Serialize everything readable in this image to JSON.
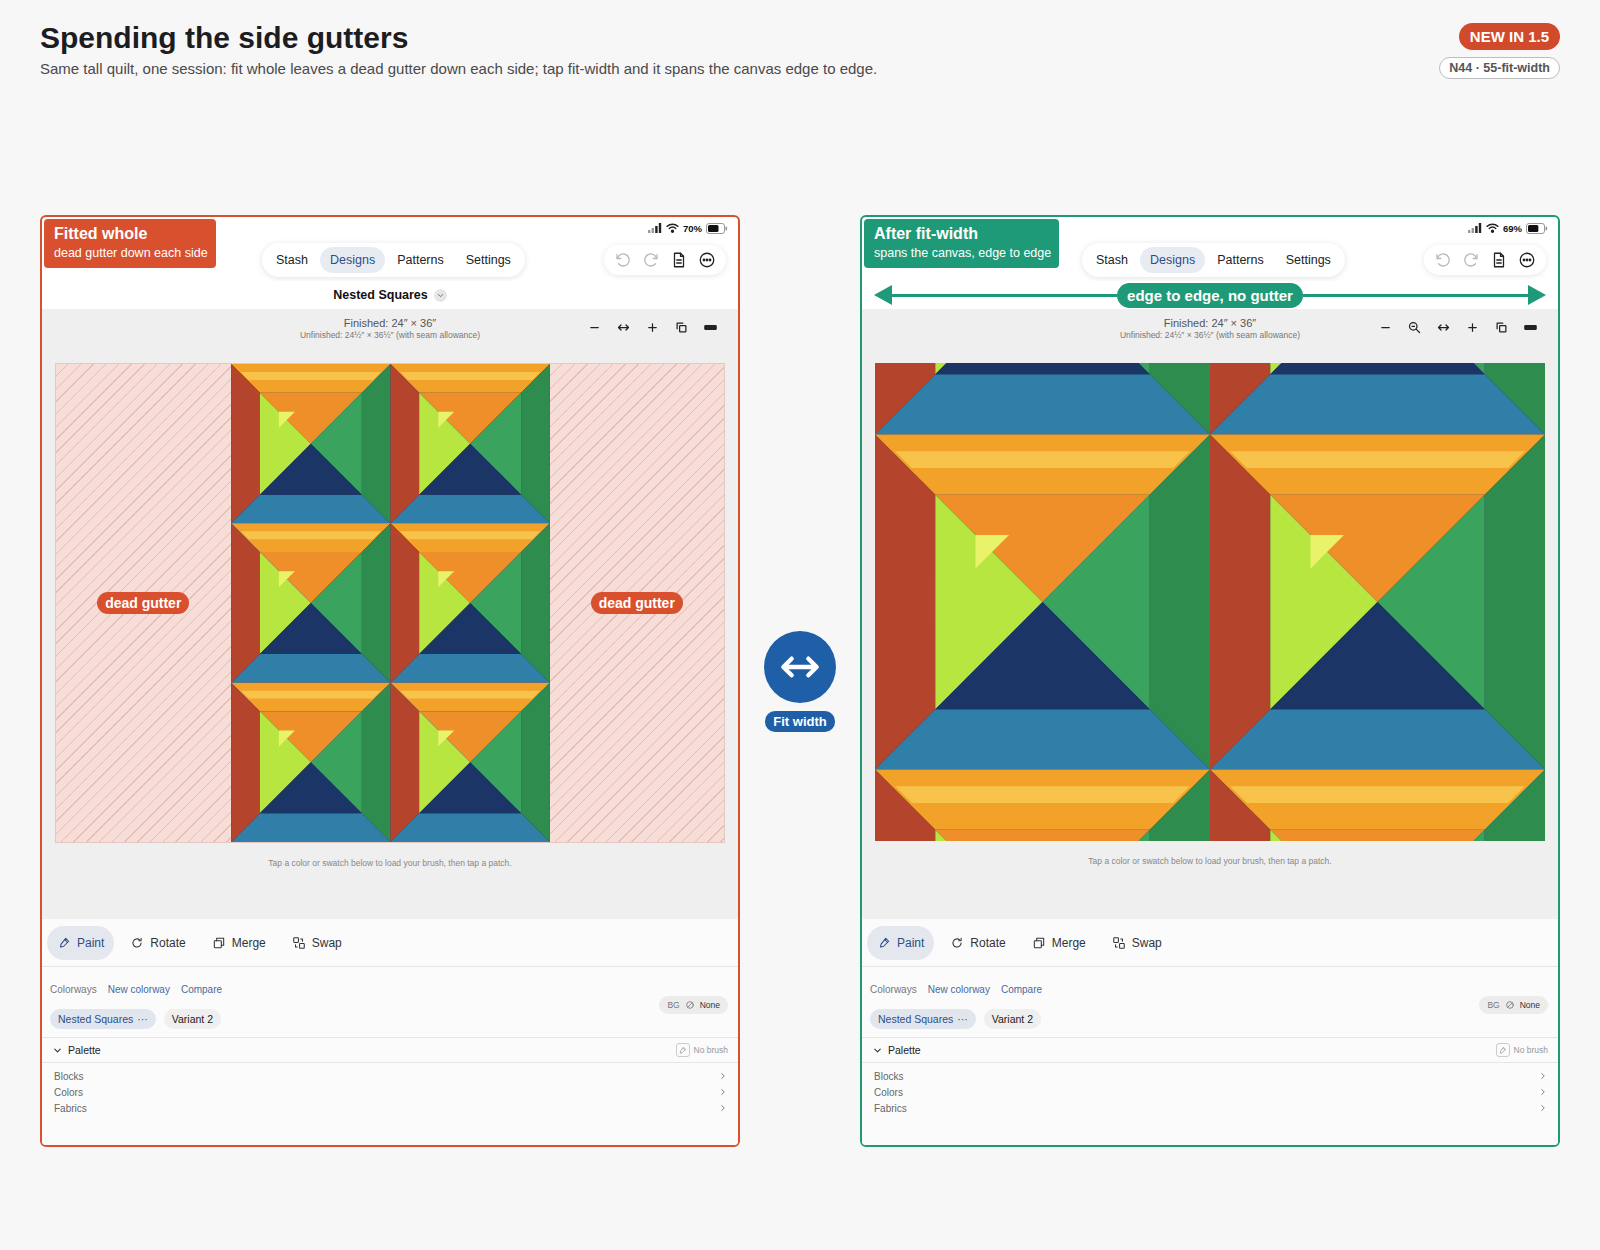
{
  "title": "Spending the side gutters",
  "subtitle": "Same tall quilt, one session: fit whole leaves a dead gutter down each side; tap fit-width and it spans the canvas edge to edge.",
  "badges": [
    {
      "label": "NEW IN 1.5",
      "kind": "filled"
    },
    {
      "label": "N44 · 55-fit-width",
      "kind": "outline"
    }
  ],
  "transition": {
    "label": "Fit width"
  },
  "panels": [
    {
      "fit": "whole",
      "color": "#d9502e",
      "callout": {
        "title": "Fitted whole",
        "subtitle": "dead gutter down each side"
      },
      "gutter_labels": [
        "dead gutter",
        "dead gutter"
      ],
      "span_label": null,
      "status": {
        "battery": "70%",
        "battery_level": 0.7
      },
      "tabs": [
        {
          "label": "Stash",
          "selected": false
        },
        {
          "label": "Designs",
          "selected": true
        },
        {
          "label": "Patterns",
          "selected": false
        },
        {
          "label": "Settings",
          "selected": false
        }
      ],
      "actions": [
        {
          "kind": "undo",
          "disabled": true
        },
        {
          "kind": "redo",
          "disabled": true
        },
        {
          "kind": "doc",
          "disabled": false
        },
        {
          "kind": "more",
          "disabled": false
        }
      ],
      "design_title": "Nested Squares",
      "finished": "Finished: 24″ × 36″",
      "unfinished": "Unfinished: 24½″ × 36½″ (with seam allowance)",
      "canvas_tools": [
        {
          "kind": "zoom-out"
        },
        {
          "kind": "fit-width"
        },
        {
          "kind": "zoom-in"
        },
        {
          "kind": "rotate-canvas"
        },
        {
          "kind": "fit-height"
        }
      ],
      "quilt": {
        "blocks_across": 2,
        "blocks_down": 3
      },
      "hint": "Tap a color or swatch below to load your brush, then tap a patch.",
      "tools": [
        {
          "label": "Paint",
          "kind": "paint",
          "selected": true
        },
        {
          "label": "Rotate",
          "kind": "rotate",
          "selected": false
        },
        {
          "label": "Merge",
          "kind": "merge",
          "selected": false
        },
        {
          "label": "Swap",
          "kind": "swap",
          "selected": false
        }
      ],
      "colorway_links": [
        {
          "label": "Colorways",
          "kind": "heading"
        },
        {
          "label": "New colorway",
          "kind": "link"
        },
        {
          "label": "Compare",
          "kind": "link"
        }
      ],
      "background": {
        "label": "BG",
        "value": "None"
      },
      "colorways": [
        {
          "label": "Nested Squares",
          "more": "···",
          "selected": true
        },
        {
          "label": "Variant 2",
          "more": null,
          "selected": false
        }
      ],
      "palette": {
        "label": "Palette",
        "expanded": true,
        "brush": "No brush",
        "sections": [
          "Blocks",
          "Colors",
          "Fabrics"
        ]
      }
    },
    {
      "fit": "width",
      "color": "#1f9a78",
      "callout": {
        "title": "After fit-width",
        "subtitle": "spans the canvas, edge to edge"
      },
      "gutter_labels": [],
      "span_label": "edge to edge, no gutter",
      "status": {
        "battery": "69%",
        "battery_level": 0.69
      },
      "tabs": [
        {
          "label": "Stash",
          "selected": false
        },
        {
          "label": "Designs",
          "selected": true
        },
        {
          "label": "Patterns",
          "selected": false
        },
        {
          "label": "Settings",
          "selected": false
        }
      ],
      "actions": [
        {
          "kind": "undo",
          "disabled": true
        },
        {
          "kind": "redo",
          "disabled": true
        },
        {
          "kind": "doc",
          "disabled": false
        },
        {
          "kind": "more",
          "disabled": false
        }
      ],
      "design_title": null,
      "finished": "Finished: 24″ × 36″",
      "unfinished": "Unfinished: 24½″ × 36½″ (with seam allowance)",
      "canvas_tools": [
        {
          "kind": "zoom-out"
        },
        {
          "kind": "zoom"
        },
        {
          "kind": "fit-width"
        },
        {
          "kind": "zoom-in"
        },
        {
          "kind": "rotate-canvas"
        },
        {
          "kind": "fit-height"
        }
      ],
      "quilt": {
        "blocks_across": 2,
        "blocks_down": 3
      },
      "hint": "Tap a color or swatch below to load your brush, then tap a patch.",
      "tools": [
        {
          "label": "Paint",
          "kind": "paint",
          "selected": true
        },
        {
          "label": "Rotate",
          "kind": "rotate",
          "selected": false
        },
        {
          "label": "Merge",
          "kind": "merge",
          "selected": false
        },
        {
          "label": "Swap",
          "kind": "swap",
          "selected": false
        }
      ],
      "colorway_links": [
        {
          "label": "Colorways",
          "kind": "heading"
        },
        {
          "label": "New colorway",
          "kind": "link"
        },
        {
          "label": "Compare",
          "kind": "link"
        }
      ],
      "background": {
        "label": "BG",
        "value": "None"
      },
      "colorways": [
        {
          "label": "Nested Squares",
          "more": "···",
          "selected": true
        },
        {
          "label": "Variant 2",
          "more": null,
          "selected": false
        }
      ],
      "palette": {
        "label": "Palette",
        "expanded": true,
        "brush": "No brush",
        "sections": [
          "Blocks",
          "Colors",
          "Fabrics"
        ]
      }
    }
  ]
}
